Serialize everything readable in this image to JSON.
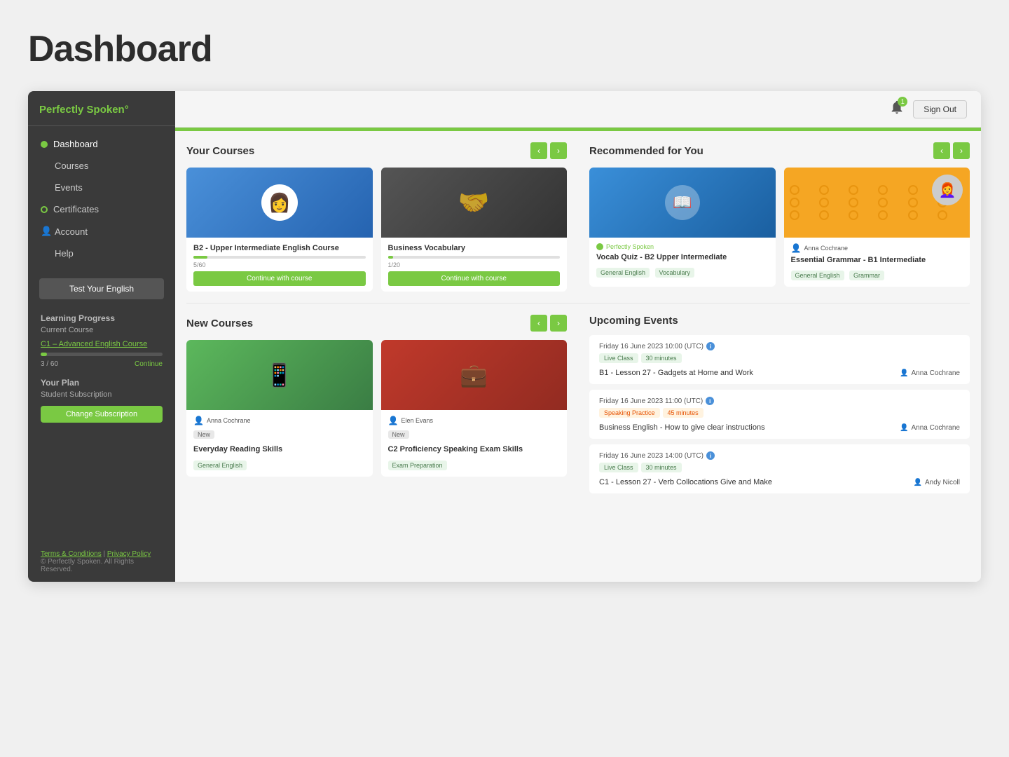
{
  "pageTitle": "Dashboard",
  "appName": "Perfectly Spoken",
  "appNameAccent": "°",
  "topbar": {
    "bellBadge": "1",
    "signOut": "Sign Out"
  },
  "sidebar": {
    "navItems": [
      {
        "label": "Dashboard",
        "active": true,
        "icon": "circle"
      },
      {
        "label": "Courses",
        "active": false
      },
      {
        "label": "Events",
        "active": false
      },
      {
        "label": "Certificates",
        "active": false,
        "icon": "circle-empty"
      },
      {
        "label": "Account",
        "active": false,
        "icon": "person"
      },
      {
        "label": "Help",
        "active": false
      }
    ],
    "testButton": "Test Your English",
    "learningProgress": {
      "sectionLabel": "Learning Progress",
      "courseLabel": "Current Course",
      "courseName": "C1 – Advanced English Course",
      "progress": 5,
      "progressMax": 60,
      "progressLabel": "3 / 60",
      "continueLabel": "Continue"
    },
    "plan": {
      "sectionLabel": "Your Plan",
      "subscriptionLabel": "Student Subscription",
      "changeButton": "Change Subscription"
    },
    "footer": {
      "termsLabel": "Terms & Conditions",
      "privacyLabel": "Privacy Policy",
      "copyright": "© Perfectly Spoken. All Rights Reserved."
    }
  },
  "yourCourses": {
    "sectionTitle": "Your Courses",
    "prevArrow": "‹",
    "nextArrow": "›",
    "cards": [
      {
        "title": "B2 - Upper Intermediate English Course",
        "progress": 8,
        "progressLabel": "5/60",
        "buttonLabel": "Continue with course",
        "thumbType": "blue"
      },
      {
        "title": "Business Vocabulary",
        "progress": 3,
        "progressLabel": "1/20",
        "buttonLabel": "Continue with course",
        "thumbType": "people"
      }
    ]
  },
  "recommendedForYou": {
    "sectionTitle": "Recommended for You",
    "prevArrow": "‹",
    "nextArrow": "›",
    "cards": [
      {
        "provider": "Perfectly Spoken",
        "title": "Vocab Quiz - B2 Upper Intermediate",
        "tags": [
          "General English",
          "Vocabulary"
        ],
        "thumbType": "blue-quiz"
      },
      {
        "teacher": "Anna Cochrane",
        "title": "Essential Grammar - B1 Intermediate",
        "tags": [
          "General English",
          "Grammar"
        ],
        "thumbType": "pattern"
      }
    ]
  },
  "newCourses": {
    "sectionTitle": "New Courses",
    "prevArrow": "‹",
    "nextArrow": "›",
    "cards": [
      {
        "teacher": "Anna Cochrane",
        "badge": "New",
        "title": "Everyday Reading Skills",
        "tags": [
          "General English"
        ],
        "thumbType": "green"
      },
      {
        "teacher": "Elen Evans",
        "badge": "New",
        "title": "C2 Proficiency Speaking Exam Skills",
        "tags": [
          "Exam Preparation"
        ],
        "thumbType": "red"
      }
    ]
  },
  "upcomingEvents": {
    "sectionTitle": "Upcoming Events",
    "events": [
      {
        "date": "Friday 16 June 2023 10:00 (UTC)",
        "tags": [
          "Live Class",
          "30 minutes"
        ],
        "title": "B1 - Lesson 27 - Gadgets at Home and Work",
        "teacher": "Anna Cochrane",
        "tagType": "green"
      },
      {
        "date": "Friday 16 June 2023 11:00 (UTC)",
        "tags": [
          "Speaking Practice",
          "45 minutes"
        ],
        "title": "Business English - How to give clear instructions",
        "teacher": "Anna Cochrane",
        "tagType": "orange"
      },
      {
        "date": "Friday 16 June 2023 14:00 (UTC)",
        "tags": [
          "Live Class",
          "30 minutes"
        ],
        "title": "C1 - Lesson 27 - Verb Collocations Give and Make",
        "teacher": "Andy Nicoll",
        "tagType": "green"
      }
    ]
  }
}
